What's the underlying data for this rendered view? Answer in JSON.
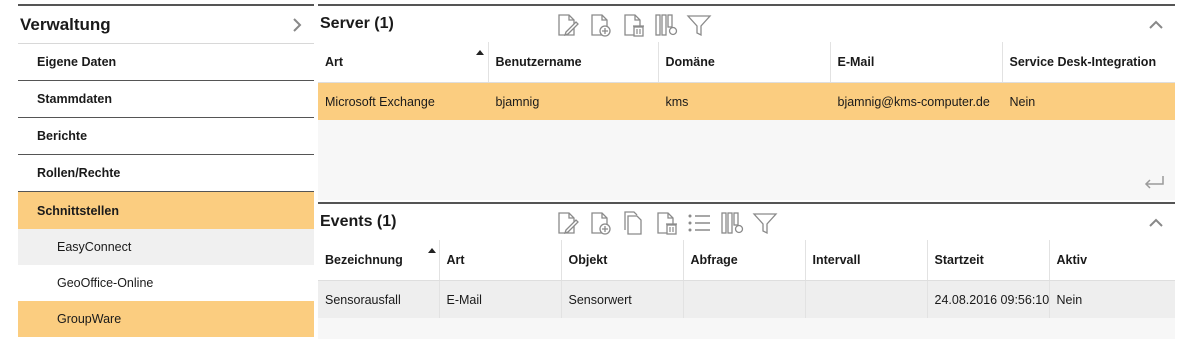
{
  "sidebar": {
    "title": "Verwaltung",
    "items": [
      {
        "label": "Eigene Daten"
      },
      {
        "label": "Stammdaten"
      },
      {
        "label": "Berichte"
      },
      {
        "label": "Rollen/Rechte"
      },
      {
        "label": "Schnittstellen"
      }
    ],
    "subitems": [
      {
        "label": "EasyConnect"
      },
      {
        "label": "GeoOffice-Online"
      },
      {
        "label": "GroupWare"
      }
    ]
  },
  "server": {
    "title": "Server (1)",
    "columns": [
      "Art",
      "Benutzername",
      "Domäne",
      "E-Mail",
      "Service Desk-Integration"
    ],
    "rows": [
      [
        "Microsoft Exchange",
        "bjamnig",
        "kms",
        "bjamnig@kms-computer.de",
        "Nein"
      ]
    ],
    "toolbar_icons": [
      "edit-icon",
      "add-icon",
      "delete-icon",
      "columns-icon",
      "filter-icon"
    ]
  },
  "events": {
    "title": "Events (1)",
    "columns": [
      "Bezeichnung",
      "Art",
      "Objekt",
      "Abfrage",
      "Intervall",
      "Startzeit",
      "Aktiv"
    ],
    "rows": [
      [
        "Sensorausfall",
        "E-Mail",
        "Sensorwert",
        "",
        "",
        "24.08.2016 09:56:10",
        "Nein"
      ]
    ],
    "toolbar_icons": [
      "edit-icon",
      "add-icon",
      "copy-icon",
      "delete-icon",
      "list-icon",
      "columns-icon",
      "filter-icon"
    ]
  },
  "colors": {
    "accent": "#fbcd80",
    "border": "#555555",
    "icon": "#8a8a8a"
  }
}
